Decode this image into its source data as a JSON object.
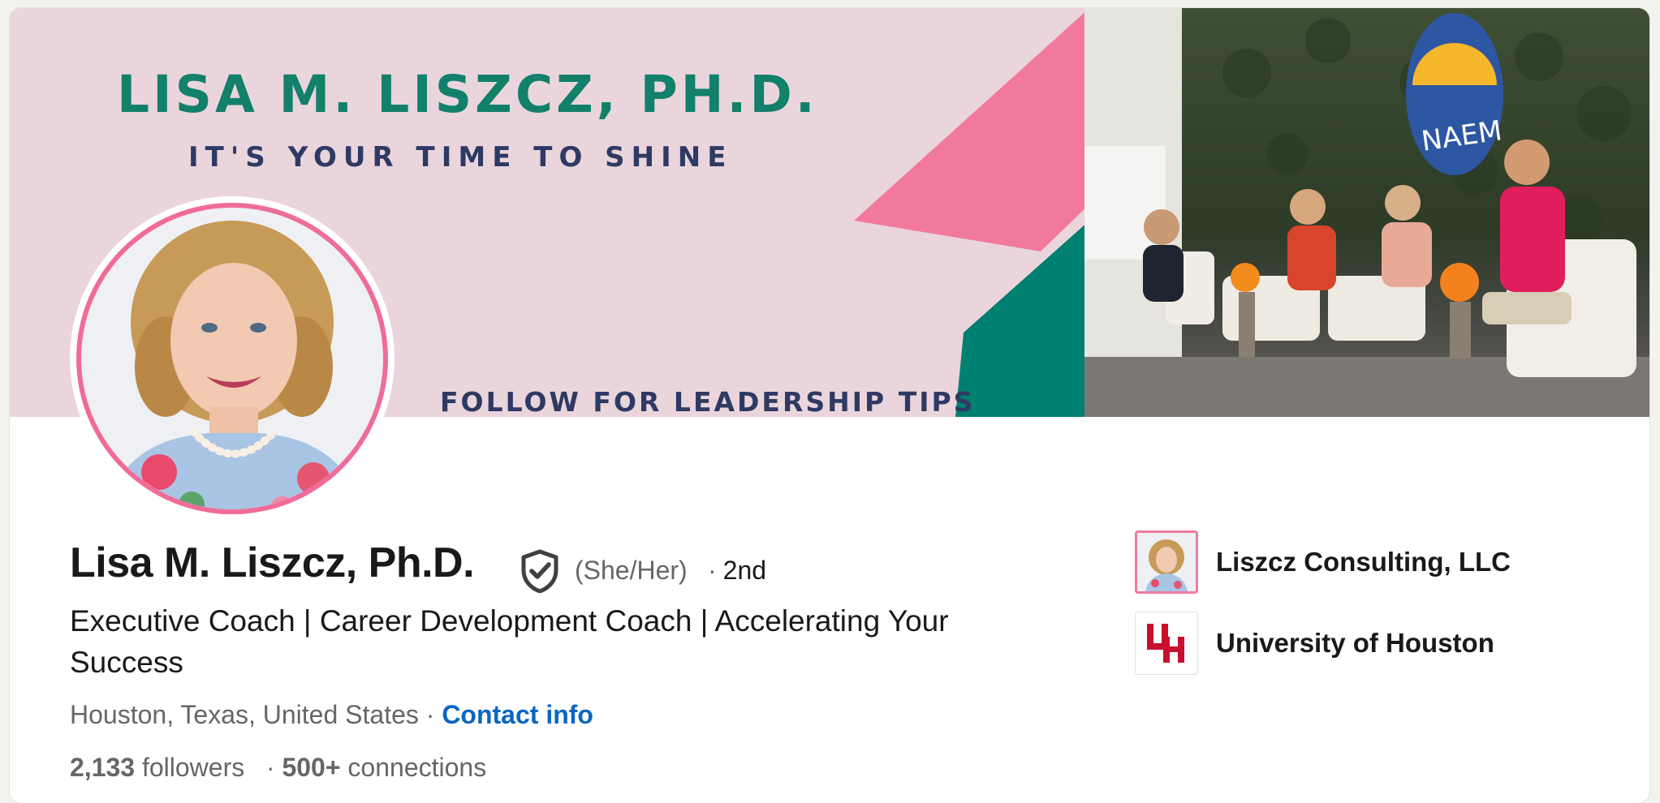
{
  "banner": {
    "title": "LISA M. LISZCZ, PH.D.",
    "tagline": "IT'S YOUR TIME TO SHINE",
    "call_to_action": "FOLLOW FOR LEADERSHIP TIPS",
    "sign_text": "NAEM",
    "colors": {
      "background": "#ead5dc",
      "pink": "#f17a9c",
      "teal": "#008070",
      "title": "#12806b",
      "navy": "#2e3a63"
    }
  },
  "profile": {
    "name": "Lisa M. Liszcz, Ph.D.",
    "pronouns": "(She/Her)",
    "degree_separator": "·",
    "connection_degree": "2nd",
    "headline": "Executive Coach | Career Development Coach | Accelerating Your Success",
    "location": "Houston, Texas, United States",
    "location_separator": "·",
    "contact_label": "Contact info",
    "followers_count": "2,133",
    "followers_label": "followers",
    "stats_separator": "·",
    "connections_count": "500+",
    "connections_label": "connections"
  },
  "organizations": [
    {
      "name": "Liszcz Consulting, LLC",
      "logo": "company-photo-logo"
    },
    {
      "name": "University of Houston",
      "logo": "uh-logo"
    }
  ],
  "colors": {
    "link": "#0a66c2",
    "text_primary": "#191919",
    "text_secondary": "#666666",
    "uh_red": "#c8102e"
  }
}
